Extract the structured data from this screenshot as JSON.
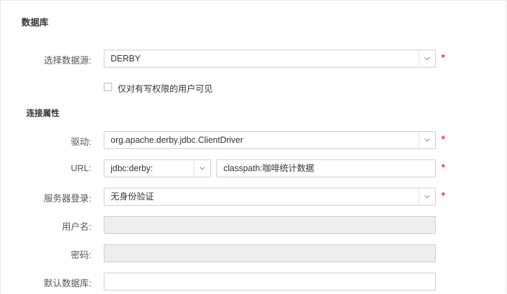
{
  "section": {
    "title": "数据库"
  },
  "datasource": {
    "label": "选择数据源:",
    "value": "DERBY",
    "required": "*",
    "write_only_checkbox": {
      "label": "仅对有写权限的用户可见",
      "checked": false
    }
  },
  "connection": {
    "title": "连接属性",
    "driver": {
      "label": "驱动:",
      "value": "org.apache.derby.jdbc.ClientDriver",
      "required": "*"
    },
    "url": {
      "label": "URL:",
      "prefix": "jdbc:derby:",
      "value": "classpath:咖啡统计数据",
      "required": "*"
    },
    "server_login": {
      "label": "服务器登录:",
      "value": "无身份验证",
      "required": "*"
    },
    "username": {
      "label": "用户名:",
      "value": ""
    },
    "password": {
      "label": "密码:",
      "value": ""
    },
    "default_database": {
      "label": "默认数据库:",
      "value": ""
    }
  },
  "colors": {
    "required": "#e8383d",
    "border": "#cfcfcf",
    "disabled_bg": "#eeeeee"
  }
}
